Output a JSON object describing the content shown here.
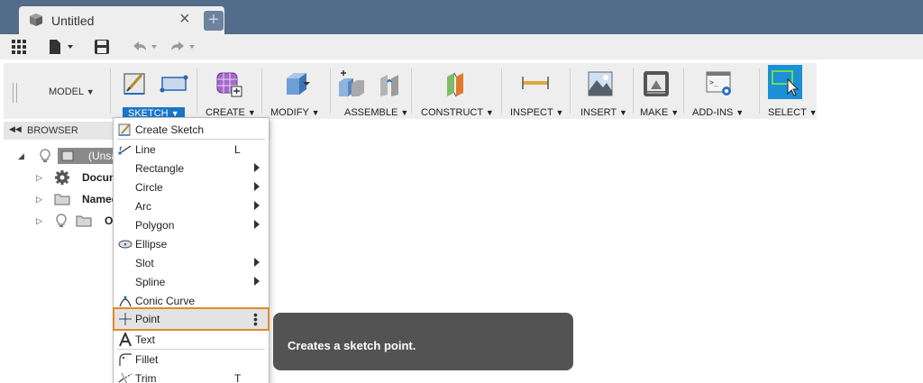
{
  "window": {
    "tab_title": "Untitled",
    "tab_close": "×",
    "tab_add": "+"
  },
  "ribbon": {
    "workspace": "MODEL",
    "groups": [
      {
        "label": "SKETCH",
        "active": true
      },
      {
        "label": "CREATE"
      },
      {
        "label": "MODIFY"
      },
      {
        "label": "ASSEMBLE"
      },
      {
        "label": "CONSTRUCT"
      },
      {
        "label": "INSPECT"
      },
      {
        "label": "INSERT"
      },
      {
        "label": "MAKE"
      },
      {
        "label": "ADD-INS"
      },
      {
        "label": "SELECT"
      }
    ]
  },
  "browser": {
    "title": "BROWSER",
    "items": [
      {
        "label": "(Unsa"
      },
      {
        "label": "Docum"
      },
      {
        "label": "Named"
      },
      {
        "label": "O"
      }
    ]
  },
  "menu": {
    "items": [
      {
        "label": "Create Sketch",
        "shortcut": "",
        "submenu": false,
        "icon": "create-sketch-icon"
      },
      {
        "label": "Line",
        "shortcut": "L",
        "submenu": false,
        "icon": "line-icon"
      },
      {
        "label": "Rectangle",
        "shortcut": "",
        "submenu": true,
        "icon": ""
      },
      {
        "label": "Circle",
        "shortcut": "",
        "submenu": true,
        "icon": ""
      },
      {
        "label": "Arc",
        "shortcut": "",
        "submenu": true,
        "icon": ""
      },
      {
        "label": "Polygon",
        "shortcut": "",
        "submenu": true,
        "icon": ""
      },
      {
        "label": "Ellipse",
        "shortcut": "",
        "submenu": false,
        "icon": "ellipse-icon"
      },
      {
        "label": "Slot",
        "shortcut": "",
        "submenu": true,
        "icon": ""
      },
      {
        "label": "Spline",
        "shortcut": "",
        "submenu": true,
        "icon": ""
      },
      {
        "label": "Conic Curve",
        "shortcut": "",
        "submenu": false,
        "icon": "conic-curve-icon"
      },
      {
        "label": "Point",
        "shortcut": "",
        "submenu": false,
        "icon": "point-icon",
        "highlighted": true
      },
      {
        "label": "Text",
        "shortcut": "",
        "submenu": false,
        "icon": "text-icon"
      },
      {
        "label": "Fillet",
        "shortcut": "",
        "submenu": false,
        "icon": "fillet-icon"
      },
      {
        "label": "Trim",
        "shortcut": "T",
        "submenu": false,
        "icon": "trim-icon"
      }
    ]
  },
  "tooltip": {
    "text": "Creates a sketch point."
  },
  "colors": {
    "titlebar": "#536c8a",
    "accent": "#1976c7",
    "highlight_border": "#e08a2a",
    "tooltip_bg": "#535353"
  }
}
